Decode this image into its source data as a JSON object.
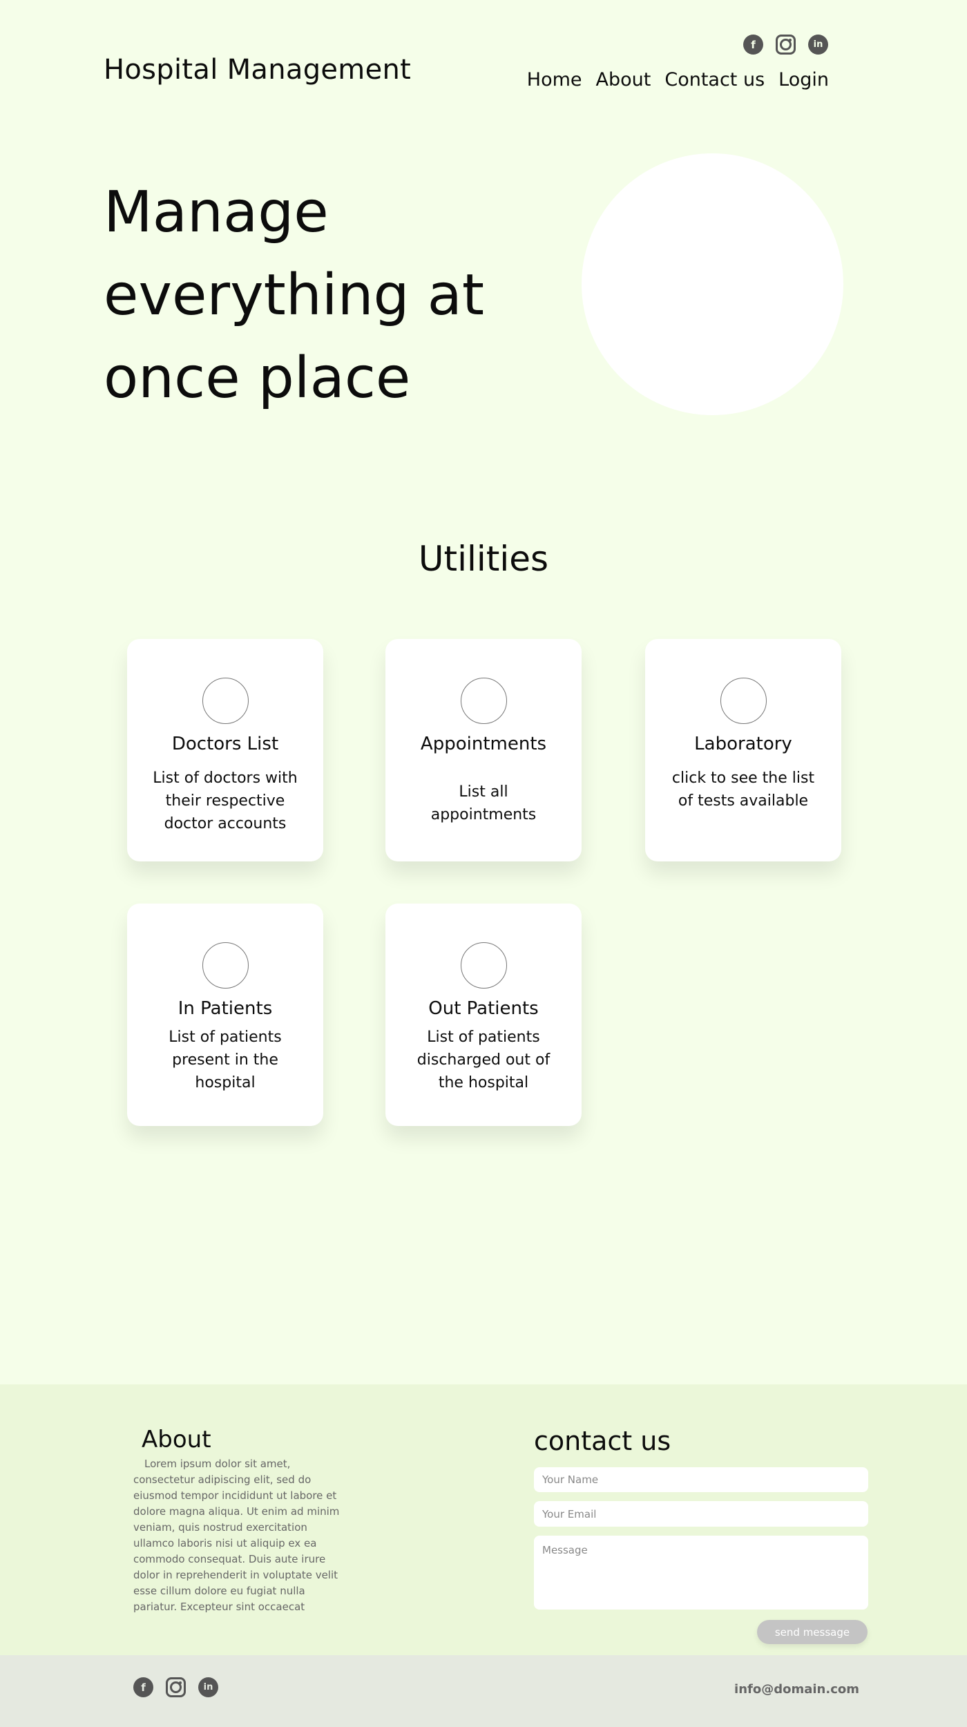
{
  "header": {
    "brand": "Hospital Management",
    "social_icons": [
      "facebook-icon",
      "instagram-icon",
      "linkedin-icon"
    ],
    "social_glyphs": {
      "facebook": "f",
      "linkedin": "in"
    },
    "nav": [
      "Home",
      "About",
      "Contact us",
      "Login"
    ]
  },
  "hero": {
    "title": "Manage everything at once place"
  },
  "utilities": {
    "title": "Utilities",
    "cards": [
      {
        "title": "Doctors List",
        "description": "List of doctors with their respective doctor accounts"
      },
      {
        "title": "Appointments",
        "description": "List all appointments"
      },
      {
        "title": "Laboratory",
        "description": "click to see the list of tests available"
      },
      {
        "title": "In Patients",
        "description": "List of patients present in the hospital"
      },
      {
        "title": "Out Patients",
        "description": "List of patients discharged out of the hospital"
      }
    ]
  },
  "footer": {
    "about": {
      "title": "About",
      "text": "Lorem ipsum dolor sit amet, consectetur adipiscing elit, sed do eiusmod tempor incididunt ut labore et dolore magna aliqua. Ut enim ad minim veniam, quis nostrud exercitation ullamco laboris nisi ut aliquip ex ea commodo consequat. Duis aute irure dolor in reprehenderit in voluptate velit esse cillum dolore eu fugiat nulla pariatur. Excepteur sint occaecat"
    },
    "contact": {
      "title": "contact us",
      "name_placeholder": "Your Name",
      "email_placeholder": "Your Email",
      "message_placeholder": "Message",
      "send_label": "send message"
    },
    "email": "info@domain.com"
  },
  "colors": {
    "page_background": "#f5fee9",
    "footer_background": "#ebf7d9",
    "bottom_bar_background": "#e5e9e0",
    "card_background": "#ffffff",
    "button_background": "#c4c4c4"
  }
}
